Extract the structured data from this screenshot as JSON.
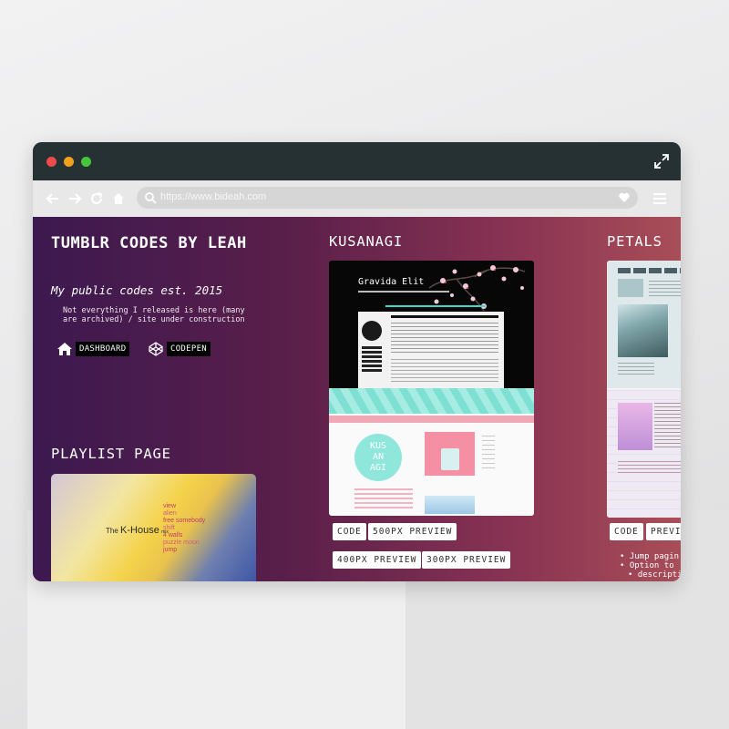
{
  "browser": {
    "url": "https://www.bideah.com",
    "colors": {
      "titlebar": "#253133",
      "close": "#ef4b4b",
      "minimize": "#f0a21a",
      "maximize": "#46c43b"
    }
  },
  "site": {
    "title": "TUMBLR CODES BY LEAH",
    "tagline": "My public codes est. 2015",
    "note": "Not everything I released is here (many are archived) / site under construction",
    "links": [
      {
        "icon": "home-icon",
        "label": "DASHBOARD"
      },
      {
        "icon": "codepen-icon",
        "label": "CODEPEN"
      }
    ]
  },
  "playlist": {
    "heading": "PLAYLIST PAGE",
    "prefix": "The",
    "title": "K-House",
    "suffix": "mix",
    "tracks": [
      "view",
      "alien",
      "free somebody",
      "shift",
      "4 walls",
      "puzzle moon",
      "jump"
    ]
  },
  "kusanagi": {
    "heading": "KUSANAGI",
    "preview_title": "Gravida Elit",
    "preview_logo": "KUS AN AGI",
    "buttons": [
      "CODE",
      "500PX PREVIEW",
      "400PX PREVIEW",
      "300PX PREVIEW"
    ]
  },
  "petals": {
    "heading": "PETALS",
    "buttons": [
      "CODE",
      "PREVIE"
    ],
    "features": [
      "Jump pagin",
      "Option to",
      "descriptio"
    ]
  }
}
